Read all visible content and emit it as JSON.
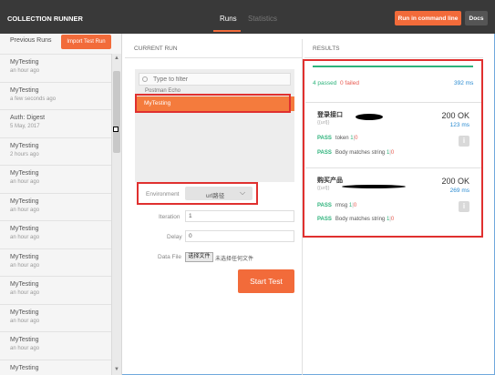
{
  "header": {
    "title": "COLLECTION RUNNER",
    "tabs": [
      {
        "label": "Runs"
      },
      {
        "label": "Statistics"
      }
    ],
    "cmd_button": "Run in command line",
    "docs_button": "Docs"
  },
  "sidebar": {
    "previous_runs_label": "Previous Runs",
    "import_button": "Import Test Run",
    "runs": [
      {
        "name": "MyTesting",
        "time": "an hour ago"
      },
      {
        "name": "MyTesting",
        "time": "a few seconds ago"
      },
      {
        "name": "Auth: Digest",
        "time": "5 May, 2017"
      },
      {
        "name": "MyTesting",
        "time": "2 hours ago"
      },
      {
        "name": "MyTesting",
        "time": "an hour ago"
      },
      {
        "name": "MyTesting",
        "time": "an hour ago"
      },
      {
        "name": "MyTesting",
        "time": "an hour ago"
      },
      {
        "name": "MyTesting",
        "time": "an hour ago"
      },
      {
        "name": "MyTesting",
        "time": "an hour ago"
      },
      {
        "name": "MyTesting",
        "time": "an hour ago"
      },
      {
        "name": "MyTesting",
        "time": "an hour ago"
      },
      {
        "name": "MyTesting",
        "time": "an hour ago"
      }
    ]
  },
  "current_run": {
    "label": "CURRENT RUN",
    "filter_placeholder": "Type to filter",
    "collection": "Postman Echo",
    "selected_folder": "MyTesting",
    "environment_label": "Environment",
    "environment_value": "url路径",
    "iteration_label": "Iteration",
    "iteration_value": "1",
    "delay_label": "Delay",
    "delay_value": "0",
    "data_file_label": "Data File",
    "choose_file": "选择文件",
    "no_file": "未选择任何文件",
    "start_button": "Start Test"
  },
  "results": {
    "label": "RESULTS",
    "passed": "4 passed",
    "failed": "0 failed",
    "total_time": "392 ms",
    "requests": [
      {
        "name": "登录接口",
        "url": "{{url}}",
        "status": "200 OK",
        "time": "123 ms",
        "tests": [
          {
            "label": "PASS",
            "name": "token",
            "ok": "1",
            "sep": "|",
            "fail": "0"
          },
          {
            "label": "PASS",
            "name": "Body matches string",
            "ok": "1",
            "sep": "|",
            "fail": "0"
          }
        ]
      },
      {
        "name": "购买产品",
        "url": "{{url}}",
        "status": "200 OK",
        "time": "269 ms",
        "tests": [
          {
            "label": "PASS",
            "name": "rmsg",
            "ok": "1",
            "sep": "|",
            "fail": "0"
          },
          {
            "label": "PASS",
            "name": "Body matches string",
            "ok": "1",
            "sep": "|",
            "fail": "0"
          }
        ]
      }
    ]
  }
}
